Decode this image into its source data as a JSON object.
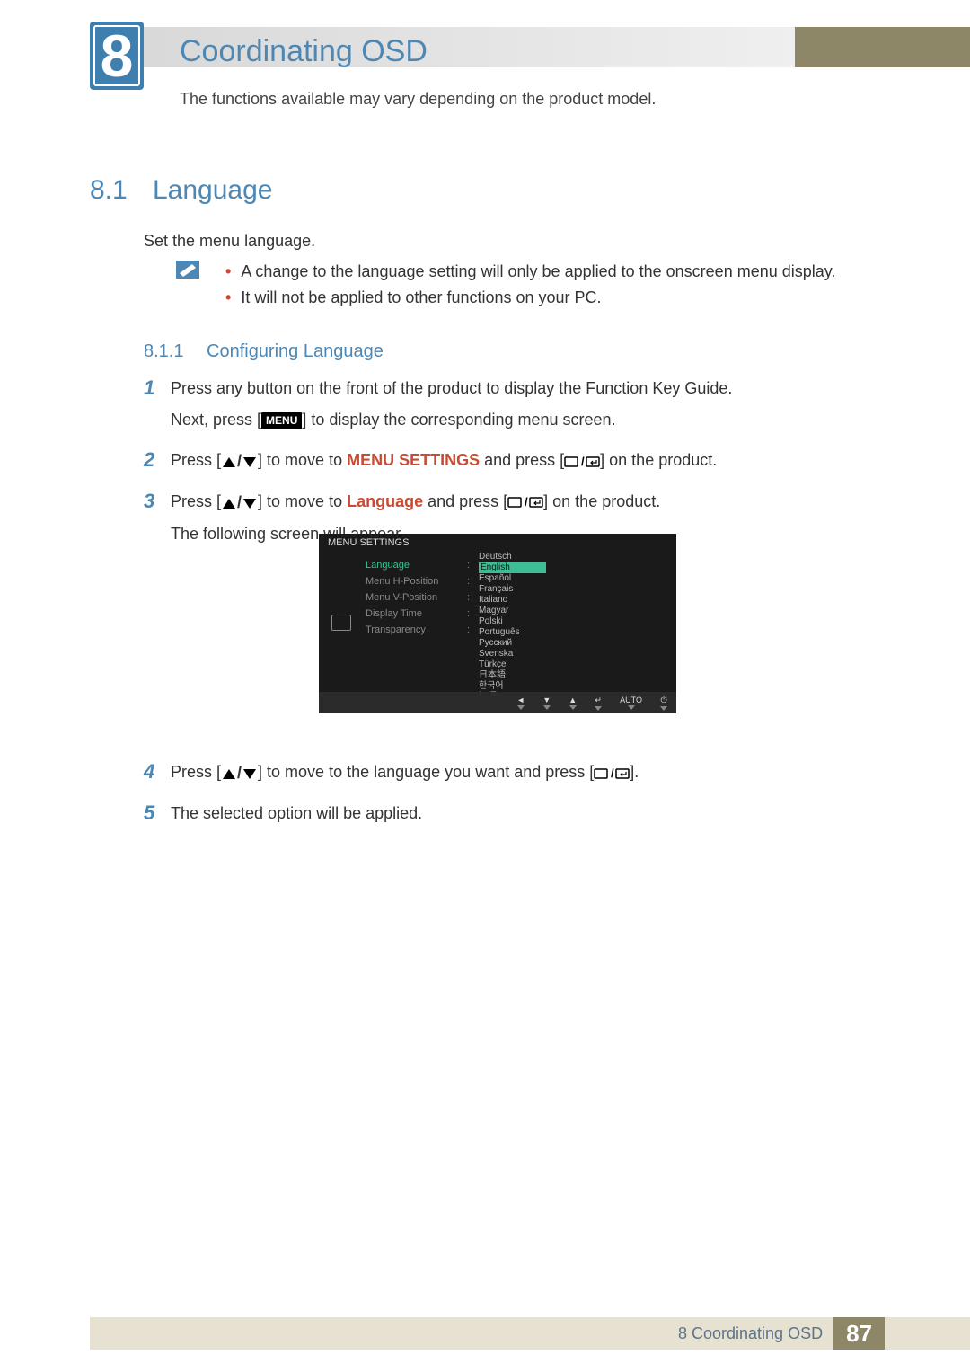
{
  "chapter": {
    "number": "8",
    "title": "Coordinating OSD",
    "note": "The functions available may vary depending on the product model."
  },
  "sections": {
    "s81_num": "8.1",
    "s81_title": "Language",
    "s81_body": "Set the menu language.",
    "notes": [
      "A change to the language setting will only be applied to the onscreen menu display.",
      "It will not be applied to other functions on your PC."
    ],
    "s811_num": "8.1.1",
    "s811_title": "Configuring Language"
  },
  "buttons": {
    "menu": "MENU"
  },
  "steps": {
    "s1a": "Press any button on the front of the product to display the Function Key Guide.",
    "s1b_pre": "Next, press [",
    "s1b_post": "] to display the corresponding menu screen.",
    "s2_pre": "Press [",
    "s2_mid": "] to move to ",
    "s2_target": "MENU SETTINGS",
    "s2_post1": " and press [",
    "s2_post2": "] on the product.",
    "s3_pre": "Press [",
    "s3_mid": "] to move to ",
    "s3_target": "Language",
    "s3_post1": " and press [",
    "s3_post2": "] on the product.",
    "s3_next": "The following screen will appear.",
    "s4_pre": "Press [",
    "s4_mid": "] to move to the language you want and press [",
    "s4_post": "].",
    "s5": "The selected option will be applied."
  },
  "osd": {
    "header": "MENU SETTINGS",
    "menu": [
      "Language",
      "Menu H-Position",
      "Menu V-Position",
      "Display Time",
      "Transparency"
    ],
    "langs": [
      "Deutsch",
      "English",
      "Español",
      "Français",
      "Italiano",
      "Magyar",
      "Polski",
      "Português",
      "Русский",
      "Svenska",
      "Türkçe",
      "日本語",
      "한국어",
      "汉语"
    ],
    "selected_lang_index": 1,
    "footer_labels": [
      "◄",
      "▼",
      "▲",
      "↵",
      "AUTO",
      "⏻"
    ]
  },
  "footer": {
    "chapter_ref": "8 Coordinating OSD",
    "page": "87"
  }
}
